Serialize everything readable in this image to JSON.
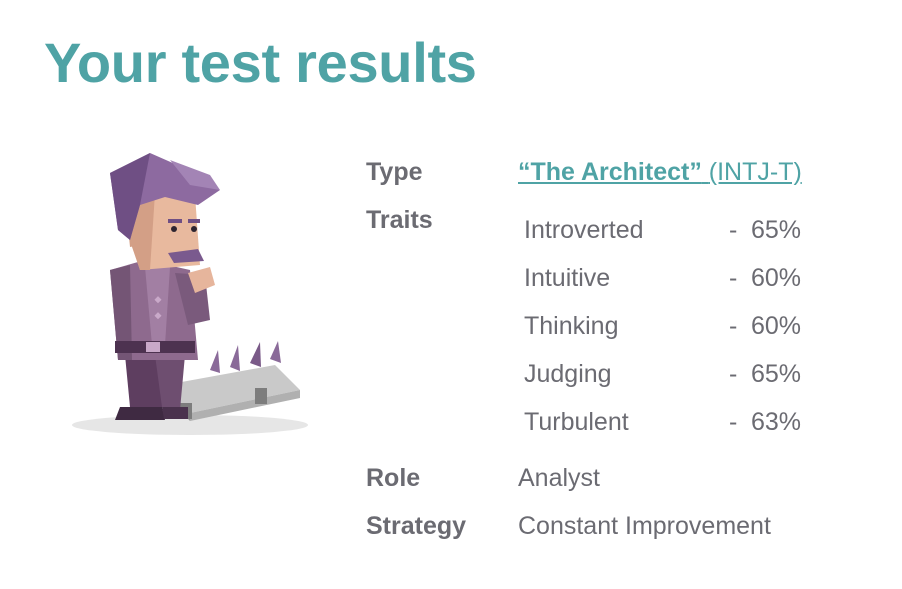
{
  "page": {
    "title": "Your test results"
  },
  "results": {
    "type_label": "Type",
    "type_name": "“The Architect”",
    "type_code": "(INTJ-T)",
    "traits_label": "Traits",
    "traits": [
      {
        "name": "Introverted",
        "dash": "-",
        "percent": "65%"
      },
      {
        "name": "Intuitive",
        "dash": "-",
        "percent": "60%"
      },
      {
        "name": "Thinking",
        "dash": "-",
        "percent": "60%"
      },
      {
        "name": "Judging",
        "dash": "-",
        "percent": "65%"
      },
      {
        "name": "Turbulent",
        "dash": "-",
        "percent": "63%"
      }
    ],
    "role_label": "Role",
    "role_value": "Analyst",
    "strategy_label": "Strategy",
    "strategy_value": "Constant Improvement"
  },
  "colors": {
    "accent": "#4fa3a5",
    "text": "#6b6b72"
  },
  "illustration": {
    "icon": "architect-character-illustration"
  }
}
